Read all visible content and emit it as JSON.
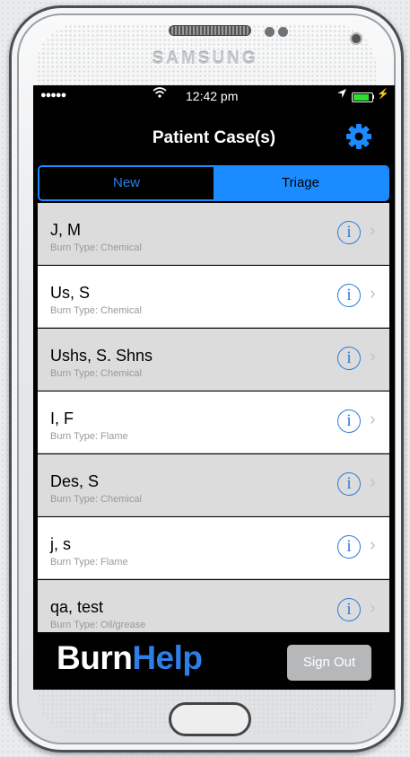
{
  "device": {
    "brand": "SAMSUNG"
  },
  "status_bar": {
    "signal": "●●●●●",
    "time": "12:42 pm",
    "battery_level": 0.85
  },
  "nav": {
    "title": "Patient Case(s)"
  },
  "segment": {
    "options": [
      {
        "label": "New",
        "selected": false
      },
      {
        "label": "Triage",
        "selected": true
      }
    ]
  },
  "patients": [
    {
      "name": "J, M",
      "burn_type": "Burn Type: Chemical"
    },
    {
      "name": "Us, S",
      "burn_type": "Burn Type: Chemical"
    },
    {
      "name": "Ushs, S. Shns",
      "burn_type": "Burn Type: Chemical"
    },
    {
      "name": "I, F",
      "burn_type": "Burn Type: Flame"
    },
    {
      "name": "Des, S",
      "burn_type": "Burn Type: Chemical"
    },
    {
      "name": "j, s",
      "burn_type": "Burn Type: Flame"
    },
    {
      "name": "qa, test",
      "burn_type": "Burn Type: Oil/grease"
    }
  ],
  "footer": {
    "logo_part1": "Burn",
    "logo_part2": "Help",
    "sign_out_label": "Sign Out"
  },
  "colors": {
    "accent": "#1a8cff",
    "info_icon": "#2f7cd9",
    "logo_blue": "#2e7fe5",
    "row_alt": "#dcdcdc"
  },
  "icons": {
    "settings": "gear-icon",
    "row_info": "info-icon",
    "row_chevron": "chevron-right-icon",
    "wifi": "wifi-icon",
    "location": "location-arrow-icon",
    "battery": "battery-icon"
  }
}
